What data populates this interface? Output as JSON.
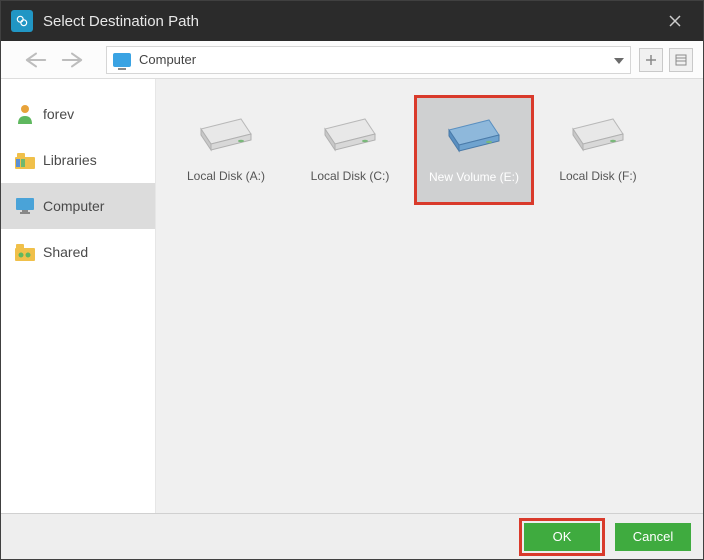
{
  "window": {
    "title": "Select Destination Path"
  },
  "toolbar": {
    "path_label": "Computer"
  },
  "sidebar": {
    "items": [
      {
        "label": "forev",
        "icon": "user-icon"
      },
      {
        "label": "Libraries",
        "icon": "libraries-icon"
      },
      {
        "label": "Computer",
        "icon": "computer-icon"
      },
      {
        "label": "Shared",
        "icon": "shared-folder-icon"
      }
    ]
  },
  "drives": [
    {
      "label": "Local Disk (A:)",
      "selected": false,
      "tint": "gray"
    },
    {
      "label": "Local Disk (C:)",
      "selected": false,
      "tint": "gray"
    },
    {
      "label": "New Volume (E:)",
      "selected": true,
      "tint": "blue"
    },
    {
      "label": "Local Disk (F:)",
      "selected": false,
      "tint": "gray"
    }
  ],
  "footer": {
    "ok_label": "OK",
    "cancel_label": "Cancel"
  }
}
